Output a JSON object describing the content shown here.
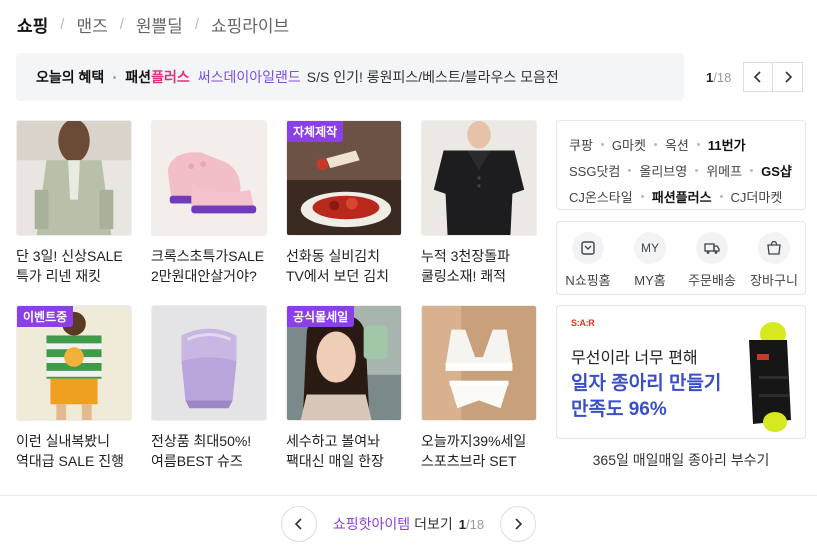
{
  "tabs": [
    "쇼핑",
    "맨즈",
    "원쁠딜",
    "쇼핑라이브"
  ],
  "promo": {
    "label": "오늘의 혜택",
    "brand_a": "패션",
    "brand_b": "플러스",
    "link": "써스데이아일랜드",
    "text": "S/S 인기! 롱원피스/베스트/블라우스 모음전",
    "page_current": "1",
    "page_total": "/18"
  },
  "products": [
    {
      "title1": "단 3일! 신상SALE",
      "title2": "특가 리넨 재킷",
      "badge": ""
    },
    {
      "title1": "크록스초특가SALE",
      "title2": "2만원대안살거야?",
      "badge": ""
    },
    {
      "title1": "선화동 실비김치",
      "title2": "TV에서 보던 김치",
      "badge": "자체제작"
    },
    {
      "title1": "누적 3천장돌파",
      "title2": "쿨링소재! 쾌적",
      "badge": ""
    },
    {
      "title1": "이런 실내복봤니",
      "title2": "역대급 SALE 진행",
      "badge": "이벤트중"
    },
    {
      "title1": "전상품 최대50%!",
      "title2": "여름BEST 슈즈",
      "badge": ""
    },
    {
      "title1": "세수하고 볼여놔",
      "title2": "팩대신 매일 한장",
      "badge": "공식몰세일"
    },
    {
      "title1": "오늘까지39%세일",
      "title2": "스포츠브라 SET",
      "badge": ""
    }
  ],
  "malls": {
    "row1": [
      "쿠팡",
      "G마켓",
      "옥션",
      "11번가"
    ],
    "row2": [
      "SSG닷컴",
      "올리브영",
      "위메프",
      "GS샵"
    ],
    "row3": [
      "CJ온스타일",
      "패션플러스",
      "CJ더마켓"
    ]
  },
  "quick_links": {
    "nshop": "N쇼핑홈",
    "my_circle": "MY",
    "my": "MY홈",
    "order": "주문배송",
    "cart": "장바구니"
  },
  "ad": {
    "logo": "S:A:R",
    "line1": "무선이라 너무 편해",
    "line2": "일자 종아리 만들기",
    "line3": "만족도 96%",
    "caption": "365일 매일매일 종아리 부수기"
  },
  "bottom": {
    "highlight": "쇼핑핫아이템",
    "more": "더보기",
    "page_current": "1",
    "page_total": "/18"
  },
  "colors": {
    "accent": "#8b3fe6",
    "brand_pink": "#e5307b",
    "ad_blue": "#3a4fc7"
  }
}
